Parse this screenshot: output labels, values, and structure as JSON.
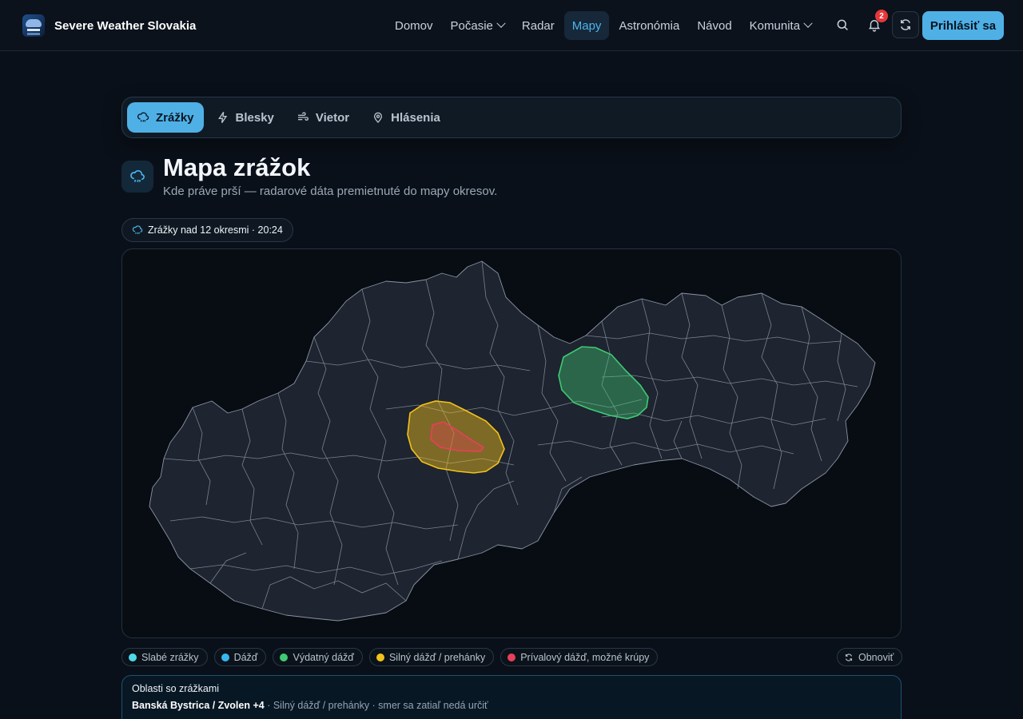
{
  "brand": {
    "name": "Severe Weather Slovakia",
    "logo_icon": "storm-logo-icon"
  },
  "nav": {
    "items": [
      {
        "label": "Domov"
      },
      {
        "label": "Počasie"
      },
      {
        "label": "Radar"
      },
      {
        "label": "Mapy"
      },
      {
        "label": "Astronómia"
      },
      {
        "label": "Návod"
      },
      {
        "label": "Komunita"
      }
    ],
    "active": "Mapy"
  },
  "header_actions": {
    "search_icon": "search-icon",
    "notifications_icon": "bell-icon",
    "notifications_count": "2",
    "refresh_icon": "refresh-icon",
    "login_label": "Prihlásiť sa"
  },
  "tabs": [
    {
      "label": "Zrážky",
      "icon": "rain-icon"
    },
    {
      "label": "Blesky",
      "icon": "lightning-icon"
    },
    {
      "label": "Vietor",
      "icon": "wind-icon"
    },
    {
      "label": "Hlásenia",
      "icon": "map-pin-icon"
    }
  ],
  "active_tab": "Zrážky",
  "page": {
    "title": "Mapa zrážok",
    "subtitle": "Kde práve prší — radarové dáta premietnuté do mapy okresov."
  },
  "status": {
    "text": "Zrážky nad 12 okresmi · 20:24"
  },
  "legend": [
    {
      "label": "Slabé zrážky",
      "color": "#4fd8e8"
    },
    {
      "label": "Dážď",
      "color": "#38b6f0"
    },
    {
      "label": "Výdatný dážď",
      "color": "#3fca74"
    },
    {
      "label": "Silný dážď / prehánky",
      "color": "#f2c21b"
    },
    {
      "label": "Prívalový dážď, možné krúpy",
      "color": "#e8405a"
    }
  ],
  "refresh_label": "Obnoviť",
  "areas": {
    "title": "Oblasti so zrážkami",
    "items": [
      {
        "name": "Banská Bystrica / Zvolen +4",
        "detail": " · Silný dážď / prehánky · smer sa zatiaľ nedá určiť"
      }
    ]
  },
  "colors": {
    "accent": "#4fb0e6",
    "map_fill": "#1e2430",
    "map_border": "#8a94a2"
  }
}
